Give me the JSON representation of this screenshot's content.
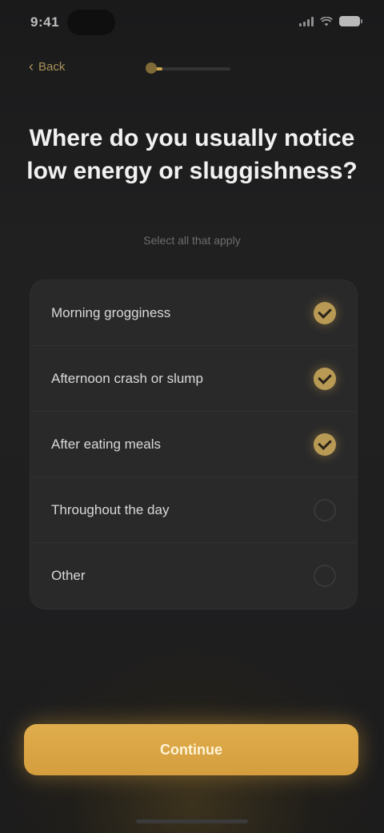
{
  "status_bar": {
    "time": "9:41"
  },
  "nav": {
    "back_label": "Back",
    "progress": 0.15
  },
  "header": {
    "title": "Where do you usually notice low energy or sluggishness?",
    "subtitle": "Select all that apply"
  },
  "options": [
    {
      "label": "Morning grogginess",
      "selected": true
    },
    {
      "label": "Afternoon crash or slump",
      "selected": true
    },
    {
      "label": "After eating meals",
      "selected": true
    },
    {
      "label": "Throughout the day",
      "selected": false
    },
    {
      "label": "Other",
      "selected": false
    }
  ],
  "cta": {
    "label": "Continue"
  },
  "colors": {
    "accent": "#d9a444",
    "background": "#1d1d1e",
    "card": "#29292a"
  },
  "icons": {
    "back": "chevron-left-icon",
    "check": "checkmark-icon"
  }
}
